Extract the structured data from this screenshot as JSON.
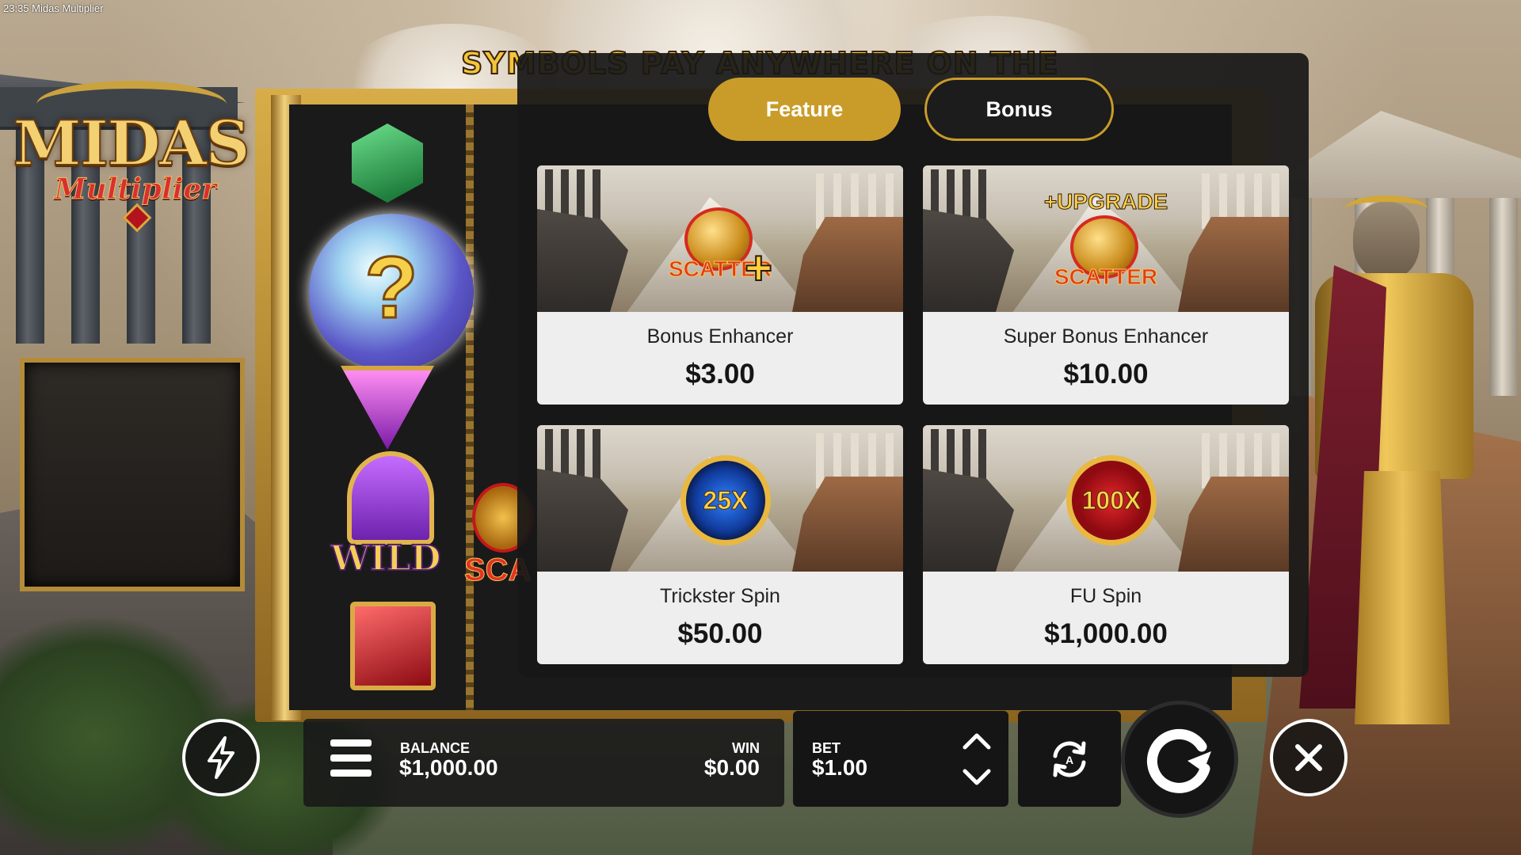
{
  "window": {
    "time": "23:35",
    "title": "Midas Multiplier"
  },
  "game": {
    "logo_main": "MIDAS",
    "logo_sub": "Multiplier",
    "banner": "SYMBOLS PAY ANYWHERE ON THE SCREEN",
    "symbols": {
      "wild": "WILD",
      "scatter_peek": "SCA",
      "orb_mark": "?"
    }
  },
  "modal": {
    "tabs": [
      {
        "label": "Feature",
        "active": true
      },
      {
        "label": "Bonus",
        "active": false
      }
    ],
    "cards": [
      {
        "name": "Bonus Enhancer",
        "price": "$3.00",
        "emblem": "scatter-plus",
        "emblem_text": "SCATTER",
        "plus": "+"
      },
      {
        "name": "Super Bonus Enhancer",
        "price": "$10.00",
        "emblem": "scatter-upgrade",
        "emblem_text": "SCATTER",
        "upgrade": "+UPGRADE"
      },
      {
        "name": "Trickster Spin",
        "price": "$50.00",
        "emblem": "medal-25x",
        "emblem_text": "25X"
      },
      {
        "name": "FU Spin",
        "price": "$1,000.00",
        "emblem": "medal-100x",
        "emblem_text": "100X"
      }
    ]
  },
  "bottom_bar": {
    "balance_label": "BALANCE",
    "balance_value": "$1,000.00",
    "win_label": "WIN",
    "win_value": "$0.00",
    "bet_label": "BET",
    "bet_value": "$1.00",
    "autoplay_badge": "A",
    "icons": [
      "lightning-icon",
      "menu-icon",
      "chevron-up-icon",
      "chevron-down-icon",
      "autoplay-icon",
      "spin-icon",
      "close-icon"
    ]
  },
  "colors": {
    "accent_gold": "#c99c2a",
    "modal_bg": "#181818",
    "card_bg": "#eeeeee"
  }
}
